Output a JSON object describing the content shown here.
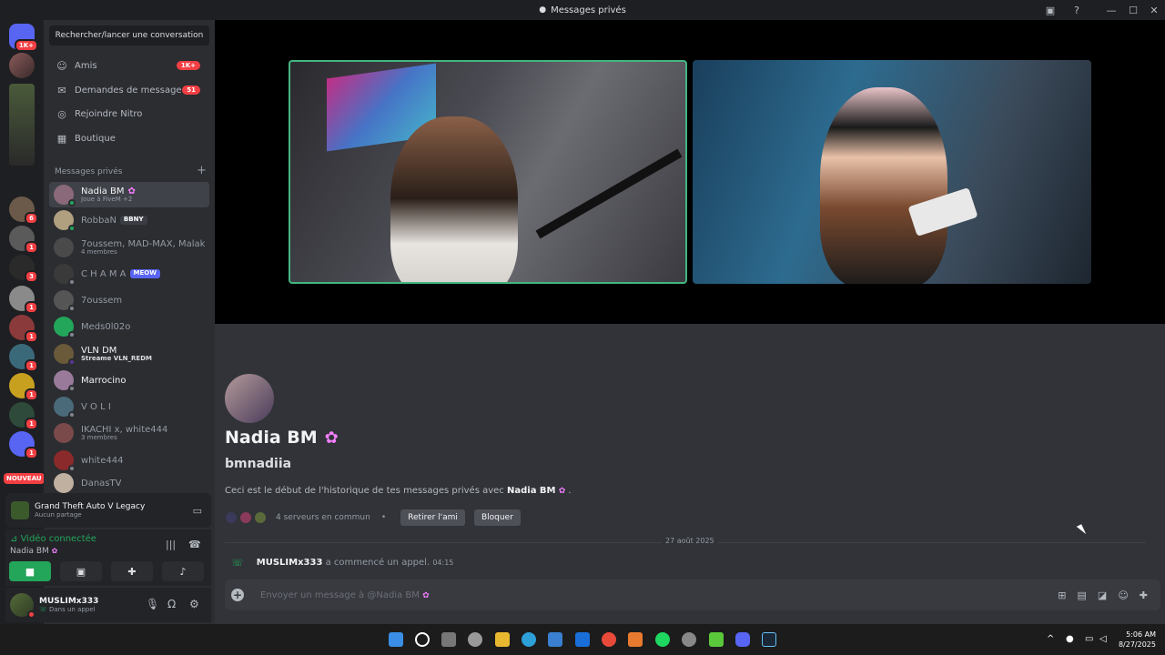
{
  "window": {
    "title": "Messages privés"
  },
  "rail": {
    "home_badge": "1K+",
    "badges": [
      "6",
      "1",
      "3",
      "1",
      "1",
      "1",
      "1",
      "1",
      "1",
      "1",
      "1"
    ],
    "new_label": "NOUVEAU"
  },
  "sidebar": {
    "search_label": "Rechercher/lancer une conversation",
    "nav": [
      {
        "label": "Amis",
        "badge": "1K+",
        "icon": "friends-icon"
      },
      {
        "label": "Demandes de message",
        "badge": "51",
        "icon": "mail-icon"
      },
      {
        "label": "Rejoindre Nitro",
        "badge": "",
        "icon": "nitro-icon"
      },
      {
        "label": "Boutique",
        "badge": "",
        "icon": "shop-icon"
      }
    ],
    "section_label": "Messages privés",
    "dms": [
      {
        "name": "Nadia BM",
        "sub": "Joue à FiveM +2",
        "tag": ""
      },
      {
        "name": "RobbaN",
        "sub": "",
        "tag": "BBNY"
      },
      {
        "name": "7oussem, MAD-MAX, Malak",
        "sub": "4 membres",
        "tag": ""
      },
      {
        "name": "C H A M A",
        "sub": "",
        "tag": "MEOW"
      },
      {
        "name": "7oussem",
        "sub": "",
        "tag": ""
      },
      {
        "name": "Meds0l02o",
        "sub": "",
        "tag": ""
      },
      {
        "name": "VLN DM",
        "sub": "Streame VLN_REDM",
        "tag": ""
      },
      {
        "name": "Marrocino",
        "sub": "",
        "tag": ""
      },
      {
        "name": "V O L I",
        "sub": "",
        "tag": ""
      },
      {
        "name": "IKACHI x, white444",
        "sub": "3 membres",
        "tag": ""
      },
      {
        "name": "white444",
        "sub": "",
        "tag": ""
      },
      {
        "name": "DanasTV",
        "sub": "",
        "tag": ""
      }
    ]
  },
  "activity": {
    "game": "Grand Theft Auto V Legacy",
    "status": "Aucun partage"
  },
  "voice": {
    "status": "Vidéo connectée",
    "channel": "Nadia BM"
  },
  "user": {
    "name": "MUSLIMx333",
    "status": "Dans un appel"
  },
  "profile": {
    "display_name": "Nadia BM",
    "username": "bmnadiia",
    "intro_prefix": "Ceci est le début de l'historique de tes messages privés avec",
    "intro_name": "Nadia BM",
    "mutual": "4 serveurs en commun",
    "remove_friend": "Retirer l'ami",
    "block": "Bloquer"
  },
  "divider_date": "27 août 2025",
  "call_message": {
    "user": "MUSLIMx333",
    "text": "a commencé un appel.",
    "time": "04:15"
  },
  "composer": {
    "placeholder": "Envoyer un message à @Nadia BM"
  },
  "taskbar": {
    "time": "5:06 AM",
    "date": "8/27/2025"
  },
  "colors": {
    "accent": "#5865f2",
    "online": "#23a55a",
    "danger": "#f23f43",
    "background": "#313338"
  }
}
